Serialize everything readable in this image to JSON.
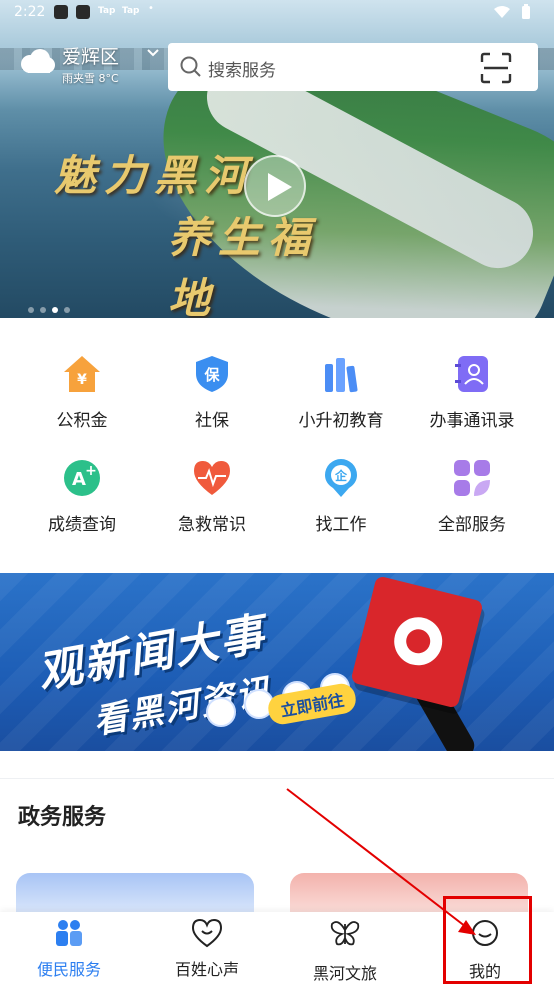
{
  "status_bar": {
    "time": "2:22",
    "tap1": "Tap",
    "tap2": "Tap",
    "dot": "•"
  },
  "header": {
    "district": "爱辉区",
    "weather": "雨夹雪 8°C",
    "search_placeholder": "搜索服务"
  },
  "hero": {
    "line1": "魅力黑河",
    "line2": "养生福地",
    "slides": 4,
    "active_slide": 3
  },
  "services": [
    {
      "label": "公积金",
      "icon": "housing-fund-icon"
    },
    {
      "label": "社保",
      "icon": "social-security-icon"
    },
    {
      "label": "小升初教育",
      "icon": "education-books-icon"
    },
    {
      "label": "办事通讯录",
      "icon": "contacts-book-icon"
    },
    {
      "label": "成绩查询",
      "icon": "grade-query-icon"
    },
    {
      "label": "急救常识",
      "icon": "first-aid-heart-icon"
    },
    {
      "label": "找工作",
      "icon": "job-search-icon"
    },
    {
      "label": "全部服务",
      "icon": "all-services-grid-icon"
    }
  ],
  "banner": {
    "line1": "观新闻大事",
    "line2": "看黑河资讯",
    "cta": "立即前往"
  },
  "gov_section": {
    "title": "政务服务"
  },
  "bottom_nav": [
    {
      "label": "便民服务",
      "icon": "people-service-icon",
      "active": true
    },
    {
      "label": "百姓心声",
      "icon": "heart-voice-icon",
      "active": false
    },
    {
      "label": "黑河文旅",
      "icon": "butterfly-tour-icon",
      "active": false
    },
    {
      "label": "我的",
      "icon": "profile-face-icon",
      "active": false
    }
  ],
  "colors": {
    "accent": "#2d7ff0",
    "annotation": "#e30000",
    "hero_title": "#e8c96e"
  }
}
